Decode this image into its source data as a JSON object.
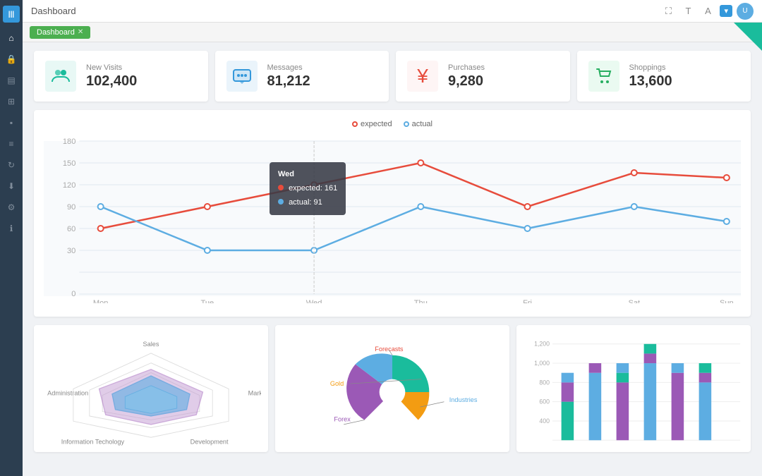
{
  "sidebar": {
    "logo": "|||",
    "items": [
      {
        "name": "home",
        "icon": "⌂",
        "active": false
      },
      {
        "name": "lock",
        "icon": "🔒",
        "active": false
      },
      {
        "name": "layers",
        "icon": "▤",
        "active": false
      },
      {
        "name": "grid",
        "icon": "⊞",
        "active": false
      },
      {
        "name": "bar-chart",
        "icon": "▪",
        "active": false
      },
      {
        "name": "list",
        "icon": "≡",
        "active": false
      },
      {
        "name": "refresh",
        "icon": "↻",
        "active": false
      },
      {
        "name": "download",
        "icon": "⬇",
        "active": false
      },
      {
        "name": "settings",
        "icon": "⚙",
        "active": false
      },
      {
        "name": "info",
        "icon": "ℹ",
        "active": false
      }
    ]
  },
  "topbar": {
    "title": "Dashboard",
    "icons": [
      "⛶",
      "T",
      "A"
    ],
    "dropdown_label": "▾",
    "avatar_initials": "U"
  },
  "tabbar": {
    "tabs": [
      {
        "label": "Dashboard",
        "closable": true
      }
    ]
  },
  "stats": [
    {
      "id": "new-visits",
      "label": "New Visits",
      "value": "102,400",
      "icon": "👥",
      "color": "teal"
    },
    {
      "id": "messages",
      "label": "Messages",
      "value": "81,212",
      "icon": "💬",
      "color": "blue"
    },
    {
      "id": "purchases",
      "label": "Purchases",
      "value": "9,280",
      "icon": "¥",
      "color": "red"
    },
    {
      "id": "shoppings",
      "label": "Shoppings",
      "value": "13,600",
      "icon": "🛒",
      "color": "green"
    }
  ],
  "line_chart": {
    "legend": {
      "expected_label": "expected",
      "actual_label": "actual"
    },
    "x_labels": [
      "Mon",
      "Tue",
      "Wed",
      "Thu",
      "Fri",
      "Sat",
      "Sun"
    ],
    "y_labels": [
      "0",
      "30",
      "60",
      "90",
      "120",
      "150",
      "180"
    ],
    "tooltip": {
      "day": "Wed",
      "expected_label": "expected",
      "expected_value": "161",
      "actual_label": "actual",
      "actual_value": "91"
    }
  },
  "bottom_charts": {
    "radar": {
      "labels": [
        "Sales",
        "Marketing",
        "Development",
        "Information Technology",
        "Administration"
      ]
    },
    "donut": {
      "segments": [
        {
          "label": "Forecasts",
          "color": "#1abc9c"
        },
        {
          "label": "Gold",
          "color": "#f39c12"
        },
        {
          "label": "Forex",
          "color": "#9b59b6"
        },
        {
          "label": "Industries",
          "color": "#5dade2"
        }
      ]
    },
    "bar": {
      "y_labels": [
        "400",
        "600",
        "800",
        "1,000",
        "1,200"
      ],
      "colors": [
        "#1abc9c",
        "#9b59b6",
        "#5dade2"
      ]
    }
  }
}
